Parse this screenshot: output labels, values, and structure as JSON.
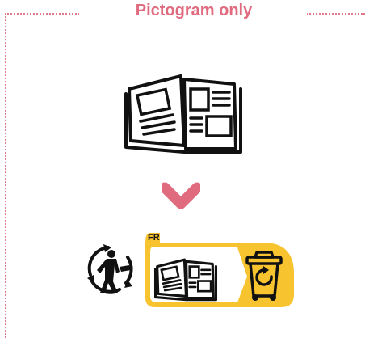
{
  "heading": "Pictogram only",
  "label": {
    "country": "FR"
  },
  "colors": {
    "accent": "#e06a7e",
    "label_yellow": "#f7c32e"
  },
  "icons": {
    "main": "open-book-icon",
    "arrow": "chevron-down-icon",
    "triman": "triman-logo-icon",
    "label_book": "open-book-icon",
    "bin": "yellow-recycling-bin-icon"
  }
}
